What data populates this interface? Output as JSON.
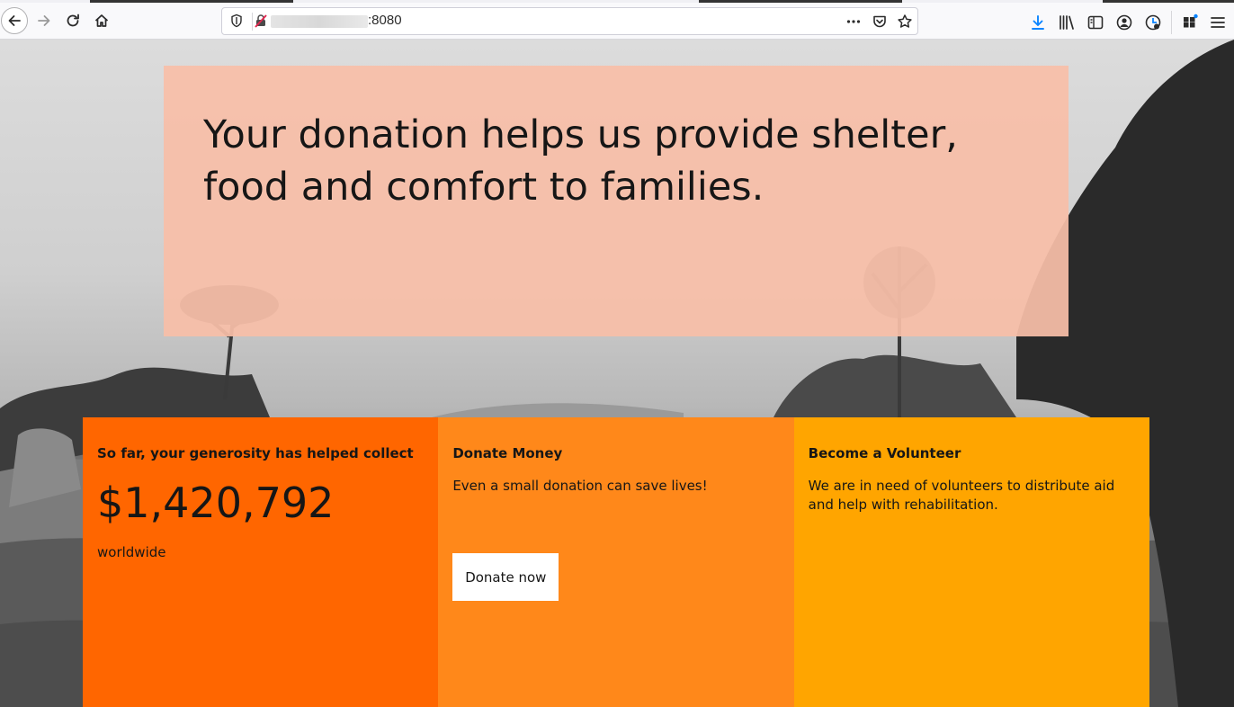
{
  "browser": {
    "url_visible_suffix": ":8080",
    "accent_color": "#0a84ff"
  },
  "hero": {
    "headline": "Your donation helps us provide shelter, food and comfort to families."
  },
  "cards": {
    "collected": {
      "title": "So far, your generosity has helped collect",
      "amount": "$1,420,792",
      "footer": "worldwide",
      "color": "#ff6600"
    },
    "donate": {
      "title": "Donate Money",
      "text": "Even a small donation can save lives!",
      "button_label": "Donate now",
      "color": "#ff881a"
    },
    "volunteer": {
      "title": "Become a Volunteer",
      "text": "We are in need of volunteers to distribute aid and help with rehabilitation.",
      "color": "#ffa500"
    }
  },
  "icons": {
    "back": "back-arrow-icon",
    "forward": "forward-arrow-icon",
    "reload": "reload-icon",
    "home": "home-icon",
    "tracking": "shield-icon",
    "insecure": "insecure-connection-icon",
    "page_actions": "more-actions-icon",
    "pocket": "pocket-icon",
    "bookmark": "star-icon",
    "downloads": "download-icon",
    "library": "library-icon",
    "sidebar": "sidebar-icon",
    "account": "account-icon",
    "extension": "extension-icon",
    "addons": "addons-icon",
    "menu": "hamburger-menu-icon"
  }
}
